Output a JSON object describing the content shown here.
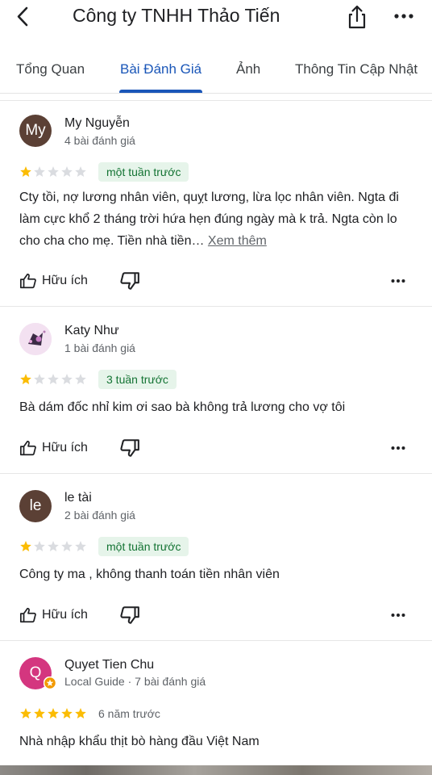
{
  "header": {
    "title": "Công ty TNHH Thảo Tiến"
  },
  "tabs": [
    {
      "label": "Tổng Quan"
    },
    {
      "label": "Bài Đánh Giá"
    },
    {
      "label": "Ảnh"
    },
    {
      "label": "Thông Tin Cập Nhật"
    }
  ],
  "reviews": [
    {
      "avatar_text": "My",
      "avatar_color": "#5b4035",
      "author": "My Nguyễn",
      "meta": "4 bài đánh giá",
      "rating": 1,
      "date": "một tuần trước",
      "text": "Cty tồi, nợ lương nhân viên, quỵt lương, lừa lọc nhân viên. Ngta đi làm cực khổ 2 tháng trời hứa hẹn đúng ngày mà k trả. Ngta còn lo cho cha cho mẹ. Tiền nhà tiền…",
      "more_label": "Xem thêm",
      "helpful_label": "Hữu ích"
    },
    {
      "avatar_text": "",
      "avatar_color": "#f1dff0",
      "author": "Katy Như",
      "meta": "1 bài đánh giá",
      "rating": 1,
      "date": "3 tuần trước",
      "text": "Bà dám đốc nhỉ kim ơi sao bà không trả lương cho vợ tôi",
      "helpful_label": "Hữu ích"
    },
    {
      "avatar_text": "le",
      "avatar_color": "#5b4035",
      "author": "le tài",
      "meta": "2 bài đánh giá",
      "rating": 1,
      "date": "một tuần trước",
      "text": "Công ty ma , không thanh toán tiền nhân viên",
      "helpful_label": "Hữu ích"
    },
    {
      "avatar_text": "Q",
      "avatar_color": "#d4367f",
      "author": "Quyet Tien Chu",
      "meta": "Local Guide · 7 bài đánh giá",
      "rating": 5,
      "date": "6 năm trước",
      "text": "Nhà nhập khẩu thịt bò hàng đầu Việt Nam"
    }
  ],
  "colors": {
    "accent": "#1a56b8",
    "star_filled": "#fbbc04",
    "star_empty": "#dadce0",
    "badge_bg": "#e6f4ea",
    "badge_text": "#137333",
    "local_guide_badge": "#f29900"
  }
}
